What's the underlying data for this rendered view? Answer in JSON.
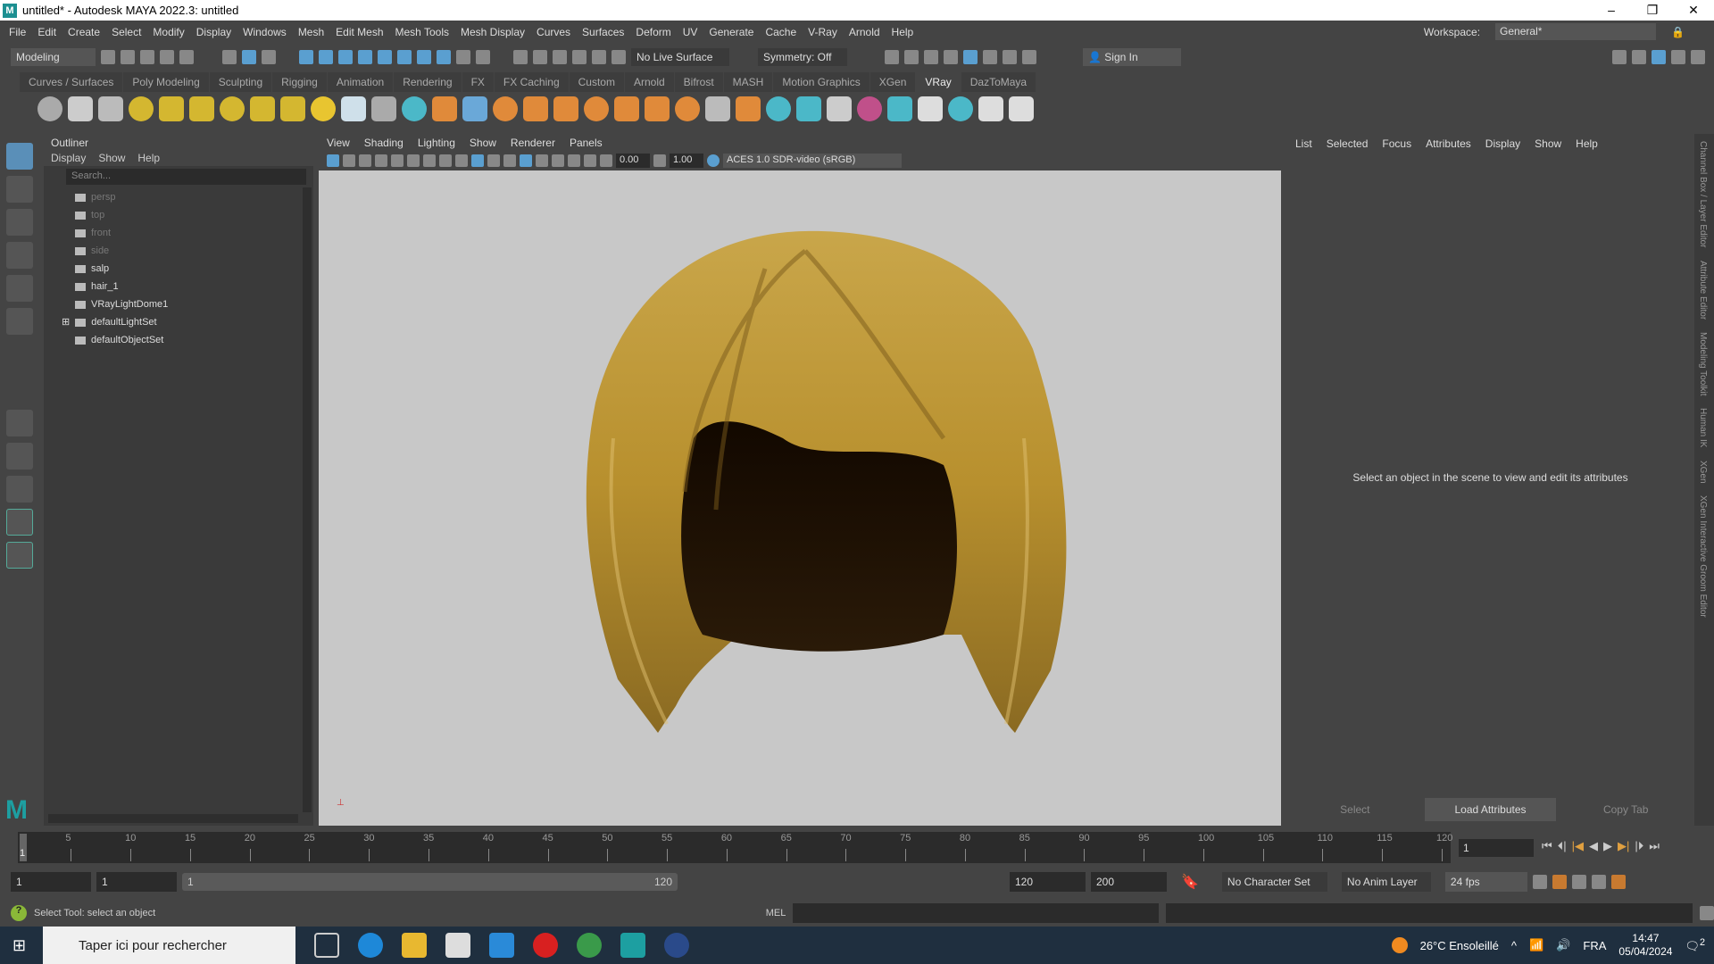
{
  "title": "untitled* - Autodesk MAYA 2022.3: untitled",
  "window_controls": [
    "–",
    "❐",
    "✕"
  ],
  "menu": [
    "File",
    "Edit",
    "Create",
    "Select",
    "Modify",
    "Display",
    "Windows",
    "Mesh",
    "Edit Mesh",
    "Mesh Tools",
    "Mesh Display",
    "Curves",
    "Surfaces",
    "Deform",
    "UV",
    "Generate",
    "Cache",
    "V-Ray",
    "Arnold",
    "Help"
  ],
  "workspace": {
    "label": "Workspace:",
    "value": "General*"
  },
  "toolbar": {
    "mode": "Modeling",
    "live_surface": "No Live Surface",
    "symmetry": "Symmetry: Off",
    "sign_in": "Sign In"
  },
  "shelf_tabs": [
    "Curves / Surfaces",
    "Poly Modeling",
    "Sculpting",
    "Rigging",
    "Animation",
    "Rendering",
    "FX",
    "FX Caching",
    "Custom",
    "Arnold",
    "Bifrost",
    "MASH",
    "Motion Graphics",
    "XGen",
    "VRay",
    "DazToMaya"
  ],
  "shelf_active": "VRay",
  "shelf_icons": [
    {
      "name": "vray-settings-icon",
      "color": "#aaa"
    },
    {
      "name": "vray-sphere-icon",
      "color": "#ccc"
    },
    {
      "name": "vray-render-icon",
      "color": "#bbb"
    },
    {
      "name": "light-bulb-icon",
      "color": "#d4b730"
    },
    {
      "name": "dome-light-icon",
      "color": "#d4b730"
    },
    {
      "name": "rect-light-icon",
      "color": "#d4b730"
    },
    {
      "name": "sphere-light-icon",
      "color": "#d4b730"
    },
    {
      "name": "mesh-light-icon",
      "color": "#d4b730"
    },
    {
      "name": "ies-light-icon",
      "color": "#d4b730"
    },
    {
      "name": "sun-light-icon",
      "color": "#e8c530"
    },
    {
      "name": "plane-icon",
      "color": "#cfe0ea"
    },
    {
      "name": "proxy-icon",
      "color": "#aaa"
    },
    {
      "name": "proxy-export-icon",
      "color": "#4bb8c8"
    },
    {
      "name": "scene-icon",
      "color": "#e08a3a"
    },
    {
      "name": "volume-icon",
      "color": "#6aa8d8"
    },
    {
      "name": "fur-icon",
      "color": "#e08a3a"
    },
    {
      "name": "displacement-icon",
      "color": "#e08a3a"
    },
    {
      "name": "grass-icon",
      "color": "#e08a3a"
    },
    {
      "name": "clipper-icon",
      "color": "#e08a3a"
    },
    {
      "name": "mesh-clipper-icon",
      "color": "#e08a3a"
    },
    {
      "name": "tile-icon",
      "color": "#e08a3a"
    },
    {
      "name": "ramp-icon",
      "color": "#e08a3a"
    },
    {
      "name": "chain-icon",
      "color": "#bbb"
    },
    {
      "name": "gear-icon",
      "color": "#e08a3a"
    },
    {
      "name": "scatter-icon",
      "color": "#4bb8c8"
    },
    {
      "name": "instancer-icon",
      "color": "#4bb8c8"
    },
    {
      "name": "file-icon",
      "color": "#ccc"
    },
    {
      "name": "material-ball-icon",
      "color": "#c0508a"
    },
    {
      "name": "multi-material-icon",
      "color": "#4bb8c8"
    },
    {
      "name": "palette-icon",
      "color": "#ddd"
    },
    {
      "name": "frame-buffer-icon",
      "color": "#4bb8c8"
    },
    {
      "name": "plug-icon",
      "color": "#ddd"
    },
    {
      "name": "vray-logo-icon",
      "color": "#ddd"
    }
  ],
  "outliner": {
    "title": "Outliner",
    "menu": [
      "Display",
      "Show",
      "Help"
    ],
    "search_placeholder": "Search...",
    "items": [
      {
        "label": "persp",
        "dim": true
      },
      {
        "label": "top",
        "dim": true
      },
      {
        "label": "front",
        "dim": true
      },
      {
        "label": "side",
        "dim": true
      },
      {
        "label": "salp"
      },
      {
        "label": "hair_1"
      },
      {
        "label": "VRayLightDome1"
      },
      {
        "label": "defaultLightSet",
        "expand": "⊞"
      },
      {
        "label": "defaultObjectSet"
      }
    ]
  },
  "viewport": {
    "menu": [
      "View",
      "Shading",
      "Lighting",
      "Show",
      "Renderer",
      "Panels"
    ],
    "exposure": "0.00",
    "gamma": "1.00",
    "color_space": "ACES 1.0 SDR-video (sRGB)"
  },
  "attribute_editor": {
    "menu": [
      "List",
      "Selected",
      "Focus",
      "Attributes",
      "Display",
      "Show",
      "Help"
    ],
    "message": "Select an object in the scene to view and edit its attributes",
    "buttons": [
      "Select",
      "Load Attributes",
      "Copy Tab"
    ]
  },
  "side_tabs": [
    "Channel Box / Layer Editor",
    "Attribute Editor",
    "Modeling Toolkit",
    "Human IK",
    "XGen",
    "XGen Interactive Groom Editor"
  ],
  "timeline": {
    "ticks": [
      5,
      10,
      15,
      20,
      25,
      30,
      35,
      40,
      45,
      50,
      55,
      60,
      65,
      70,
      75,
      80,
      85,
      90,
      95,
      100,
      105,
      110,
      115,
      120
    ],
    "start": 1,
    "end": 120,
    "current": "1",
    "current_marker": "1"
  },
  "range": {
    "start": "1",
    "playback_start": "1",
    "slider_start": "1",
    "slider_end": "120",
    "playback_end": "120",
    "end": "200",
    "character_set": "No Character Set",
    "anim_layer": "No Anim Layer",
    "fps": "24 fps"
  },
  "status": {
    "help": "Select Tool: select an object",
    "mel": "MEL"
  },
  "taskbar": {
    "search": "Taper ici pour rechercher",
    "weather": "26°C  Ensoleillé",
    "lang": "FRA",
    "time": "14:47",
    "date": "05/04/2024",
    "notifications": "2"
  }
}
